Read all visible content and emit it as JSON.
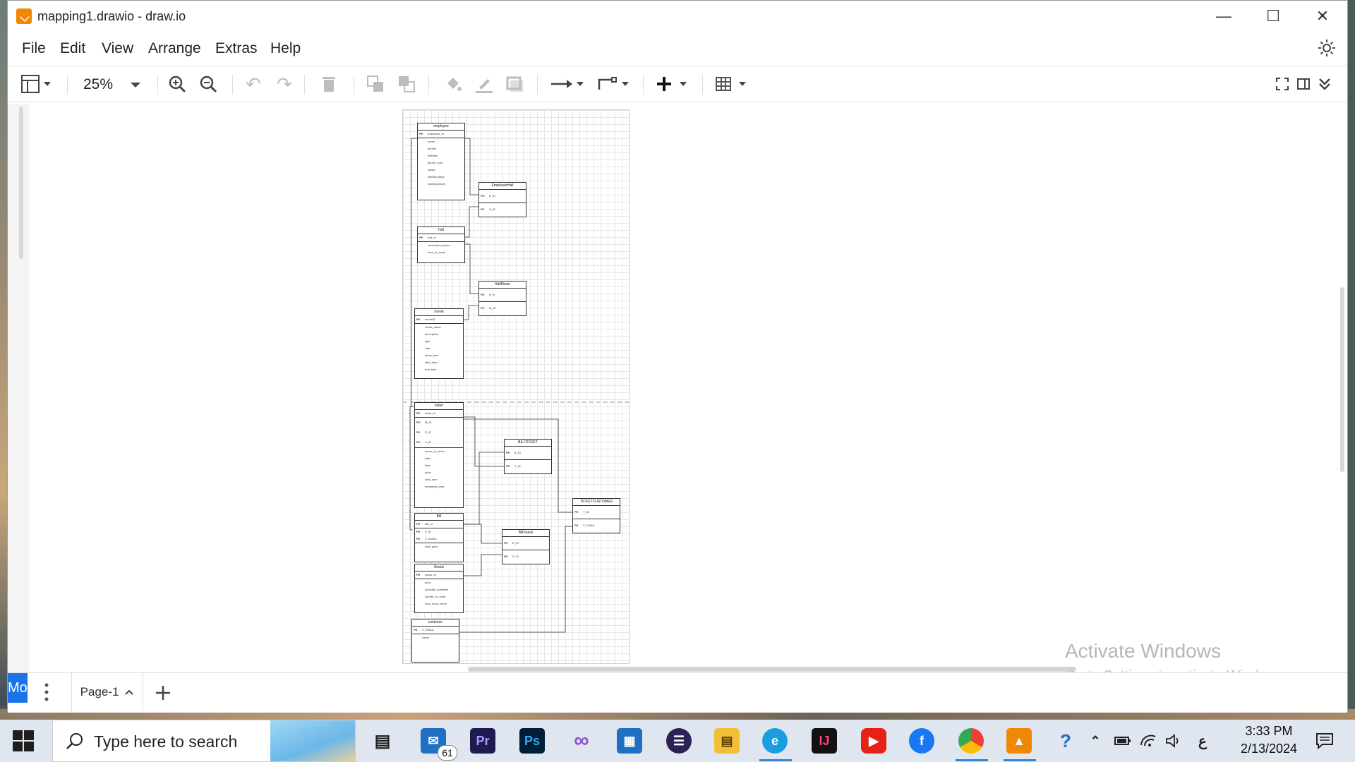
{
  "window": {
    "title": "mapping1.drawio - draw.io"
  },
  "menu": [
    "File",
    "Edit",
    "View",
    "Arrange",
    "Extras",
    "Help"
  ],
  "toolbar": {
    "zoom": "25%"
  },
  "diagram": {
    "tables": [
      {
        "id": "employee",
        "title": "employee",
        "rows": [
          {
            "k": "PK",
            "n": "employee_id"
          }
        ],
        "fields": [
          "name",
          "gender",
          "birthday",
          "phone_num",
          "salary",
          "working days",
          "working hours"
        ]
      },
      {
        "id": "employeehall",
        "title": "EmployeeHall",
        "rows": [
          {
            "k": "PK",
            "n": "E_ID"
          },
          {
            "k": "PK",
            "n": "H_ID"
          }
        ],
        "fields": []
      },
      {
        "id": "hall",
        "title": "hall",
        "rows": [
          {
            "k": "PK",
            "n": "hall_id"
          }
        ],
        "fields": [
          "reservation_times",
          "num_of_seats"
        ]
      },
      {
        "id": "hallmovie",
        "title": "HallMovie",
        "rows": [
          {
            "k": "PK",
            "n": "H_ID"
          },
          {
            "k": "PK",
            "n": "M_ID"
          }
        ],
        "fields": []
      },
      {
        "id": "movie",
        "title": "movie",
        "rows": [
          {
            "k": "PK",
            "n": "movieID"
          }
        ],
        "fields": [
          "movie_name",
          "description",
          "type",
          "date",
          "show_time",
          "start_time",
          "end_time"
        ]
      },
      {
        "id": "ticket",
        "title": "ticket",
        "rows": [
          {
            "k": "PK",
            "n": "ticket_id"
          },
          {
            "k": "FK",
            "n": "M_ID"
          },
          {
            "k": "FK",
            "n": "E_ID"
          },
          {
            "k": "FK",
            "n": "C_ID"
          }
        ],
        "fields": [
          "name_of_movie",
          "date",
          "time",
          "price",
          "seat_num",
          "remaining_seat"
        ]
      },
      {
        "id": "billticket",
        "title": "BILLTICKET",
        "rows": [
          {
            "k": "PK",
            "n": "B_ID"
          },
          {
            "k": "PK",
            "n": "T_ID"
          }
        ],
        "fields": []
      },
      {
        "id": "ticketcustomer",
        "title": "TICKETCUSTOMER",
        "rows": [
          {
            "k": "PK",
            "n": "T_ID"
          },
          {
            "k": "PK",
            "n": "C_EMAIL"
          }
        ],
        "fields": []
      },
      {
        "id": "bill",
        "title": "Bill",
        "rows": [
          {
            "k": "PK",
            "n": "Bill_id"
          },
          {
            "k": "FK",
            "n": "E_ID"
          },
          {
            "k": "FK",
            "n": "C_EMAIL"
          }
        ],
        "fields": [
          "total_price"
        ]
      },
      {
        "id": "billsnack",
        "title": "BillSnack",
        "rows": [
          {
            "k": "PK",
            "n": "B_ID"
          },
          {
            "k": "PK",
            "n": "S_ID"
          }
        ],
        "fields": []
      },
      {
        "id": "snack",
        "title": "Snack",
        "rows": [
          {
            "k": "PK",
            "n": "snack_id"
          }
        ],
        "fields": [
          "price",
          "Quantity_Available",
          "Quntity_in_order",
          "food_drink_name"
        ]
      },
      {
        "id": "customer",
        "title": "customer",
        "rows": [
          {
            "k": "PK",
            "n": "C_EMAIL"
          }
        ],
        "fields": [
          "name"
        ]
      }
    ]
  },
  "watermark": {
    "line1": "Activate Windows",
    "line2": "Go to Settings to activate Windows."
  },
  "footer": {
    "more_label": "Mor",
    "page_tab": "Page-1"
  },
  "taskbar": {
    "search_placeholder": "Type here to search",
    "mail_badge": "61",
    "time": "3:33 PM",
    "date": "2/13/2024",
    "lang": "ع",
    "apps": [
      "task-view",
      "mail",
      "premiere",
      "photoshop",
      "visual-studio",
      "microsoft-store",
      "eclipse",
      "file-explorer",
      "edge",
      "intellij",
      "youtube",
      "facebook",
      "chrome",
      "drawio"
    ]
  }
}
